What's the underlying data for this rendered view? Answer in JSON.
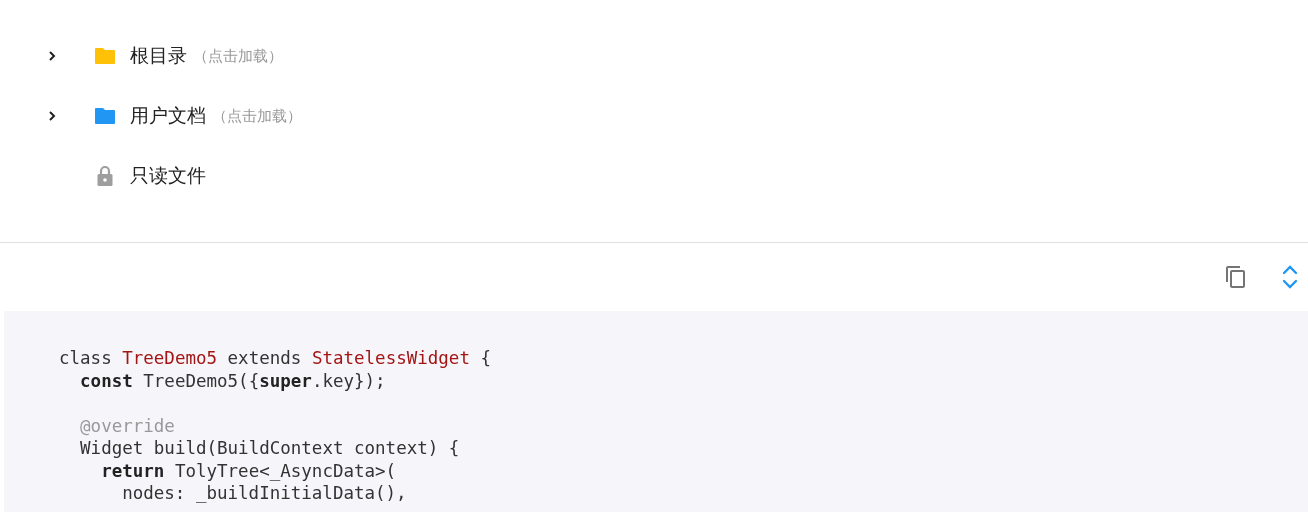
{
  "tree": [
    {
      "kind": "folder",
      "label": "根目录",
      "hint": "（点击加载）",
      "expanded": false,
      "color": "#ffc107"
    },
    {
      "kind": "folder",
      "label": "用户文档",
      "hint": "（点击加载）",
      "expanded": false,
      "color": "#2196f3"
    },
    {
      "kind": "locked",
      "label": "只读文件"
    }
  ],
  "code": {
    "lines": [
      {
        "tokens": [
          {
            "kind": "plain",
            "text": "class "
          },
          {
            "kind": "type",
            "text": "TreeDemo5"
          },
          {
            "kind": "plain",
            "text": " extends "
          },
          {
            "kind": "type",
            "text": "StatelessWidget"
          },
          {
            "kind": "plain",
            "text": " {"
          }
        ],
        "children": [
          {
            "tokens": [
              {
                "kind": "keyword",
                "text": "const"
              },
              {
                "kind": "plain",
                "text": " TreeDemo5({"
              },
              {
                "kind": "keyword",
                "text": "super"
              },
              {
                "kind": "plain",
                "text": ".key});"
              }
            ]
          },
          {
            "blank_before": true,
            "tokens": [
              {
                "kind": "annotation",
                "text": "@override"
              }
            ]
          },
          {
            "tokens": [
              {
                "kind": "plain",
                "text": "Widget build(BuildContext context) {"
              }
            ],
            "children": [
              {
                "tokens": [
                  {
                    "kind": "keyword",
                    "text": "return"
                  },
                  {
                    "kind": "plain",
                    "text": " TolyTree<_AsyncData>("
                  }
                ],
                "children": [
                  {
                    "tokens": [
                      {
                        "kind": "plain",
                        "text": "nodes: _buildInitialData(),"
                      }
                    ]
                  }
                ]
              }
            ]
          }
        ]
      }
    ]
  }
}
